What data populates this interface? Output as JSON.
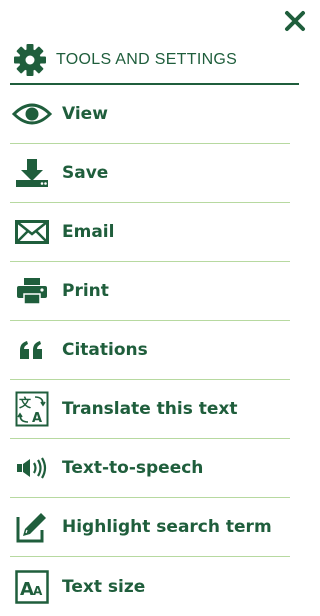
{
  "header": {
    "title": "TOOLS AND SETTINGS"
  },
  "colors": {
    "primary": "#1f5e3c",
    "divider": "#b7d9a0"
  },
  "menu": [
    {
      "label": "View",
      "icon": "eye-icon"
    },
    {
      "label": "Save",
      "icon": "download-icon"
    },
    {
      "label": "Email",
      "icon": "envelope-icon"
    },
    {
      "label": "Print",
      "icon": "printer-icon"
    },
    {
      "label": "Citations",
      "icon": "quote-icon"
    },
    {
      "label": "Translate this text",
      "icon": "translate-icon"
    },
    {
      "label": "Text-to-speech",
      "icon": "speaker-icon"
    },
    {
      "label": "Highlight search term",
      "icon": "pencil-icon"
    },
    {
      "label": "Text size",
      "icon": "text-size-icon"
    }
  ]
}
